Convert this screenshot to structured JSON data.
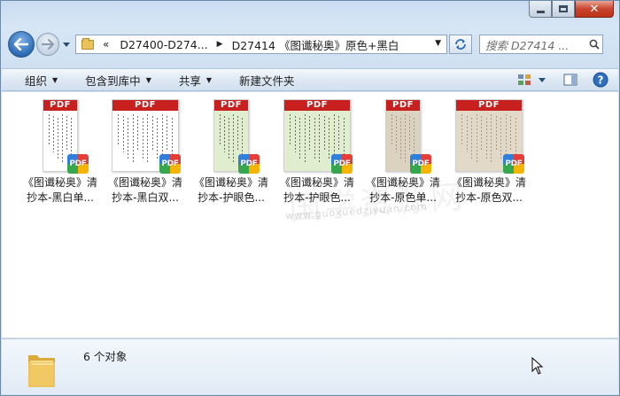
{
  "window": {
    "caption": {
      "minimize": "minimize",
      "maximize": "maximize",
      "close": "close"
    }
  },
  "nav": {
    "breadcrumb": [
      "D27400-D274...",
      "D27414 《图谶秘奥》原色+黑白"
    ],
    "overflow_chevrons": "«",
    "search_placeholder": "搜索 D27414 ..."
  },
  "toolbar": {
    "organize": "组织",
    "include_in_library": "包含到库中",
    "share": "共享",
    "new_folder": "新建文件夹"
  },
  "files": [
    {
      "line1": "《图谶秘奥》清",
      "line2": "抄本-黑白单...",
      "tint": "#ffffff",
      "badge": "PDF",
      "band": "PDF"
    },
    {
      "line1": "《图谶秘奥》清",
      "line2": "抄本-黑白双...",
      "tint": "#ffffff",
      "badge": "PDF",
      "band": "PDF"
    },
    {
      "line1": "《图谶秘奥》清",
      "line2": "抄本-护眼色...",
      "tint": "#e1edcf",
      "badge": "PDF",
      "band": "PDF"
    },
    {
      "line1": "《图谶秘奥》清",
      "line2": "抄本-护眼色...",
      "tint": "#e1edcf",
      "badge": "PDF",
      "band": "PDF"
    },
    {
      "line1": "《图谶秘奥》清",
      "line2": "抄本-原色单...",
      "tint": "#dcd2c0",
      "badge": "PDF",
      "band": "PDF"
    },
    {
      "line1": "《图谶秘奥》清",
      "line2": "抄本-原色双...",
      "tint": "#e3d9c8",
      "badge": "PDF",
      "band": "PDF"
    }
  ],
  "watermark": {
    "latin": "www.guoxuedziyuan.com"
  },
  "details": {
    "item_count": "6 个对象"
  },
  "colors": {
    "pdf_red": "#c8201f",
    "accent_blue": "#2b6cb5"
  }
}
